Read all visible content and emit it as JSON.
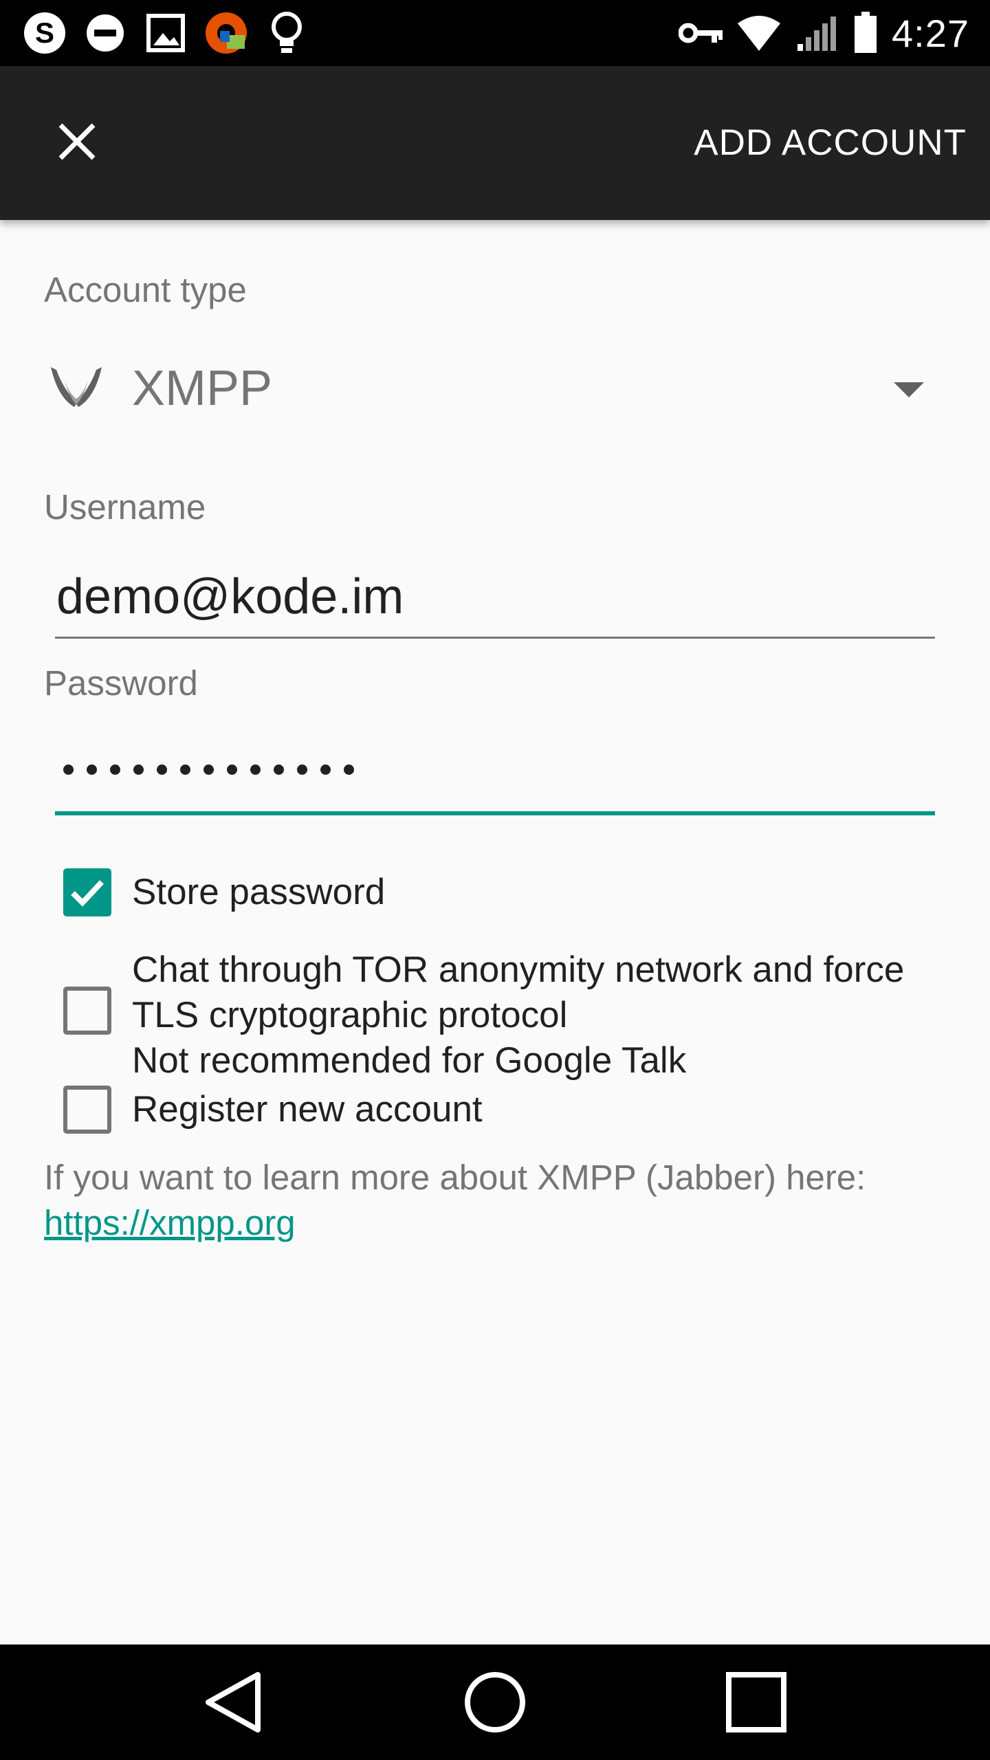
{
  "status_bar": {
    "time": "4:27",
    "left_icons": [
      "skype-icon",
      "do-not-disturb-icon",
      "image-icon",
      "vpn-app-icon",
      "lightbulb-icon"
    ],
    "right_icons": [
      "vpn-key-icon",
      "wifi-icon",
      "signal-icon",
      "battery-icon"
    ]
  },
  "toolbar": {
    "close_icon": "close-icon",
    "add_account_label": "ADD ACCOUNT"
  },
  "form": {
    "account_type_label": "Account type",
    "account_type_value": "XMPP",
    "username_label": "Username",
    "username_value": "demo@kode.im",
    "password_label": "Password",
    "password_length": 13,
    "store_password": {
      "label": "Store password",
      "checked": true
    },
    "tor": {
      "line1": "Chat through TOR anonymity network and force",
      "line2": "TLS cryptographic protocol",
      "line3": "Not recommended for Google Talk",
      "checked": false
    },
    "register": {
      "label": "Register new account",
      "checked": false
    },
    "info_text": "If you want to learn more about XMPP (Jabber) here:",
    "info_link": "https://xmpp.org"
  },
  "colors": {
    "accent": "#009688",
    "toolbar": "#212121",
    "background": "#fafafa"
  },
  "nav_bar": [
    "back-icon",
    "home-icon",
    "recents-icon"
  ]
}
